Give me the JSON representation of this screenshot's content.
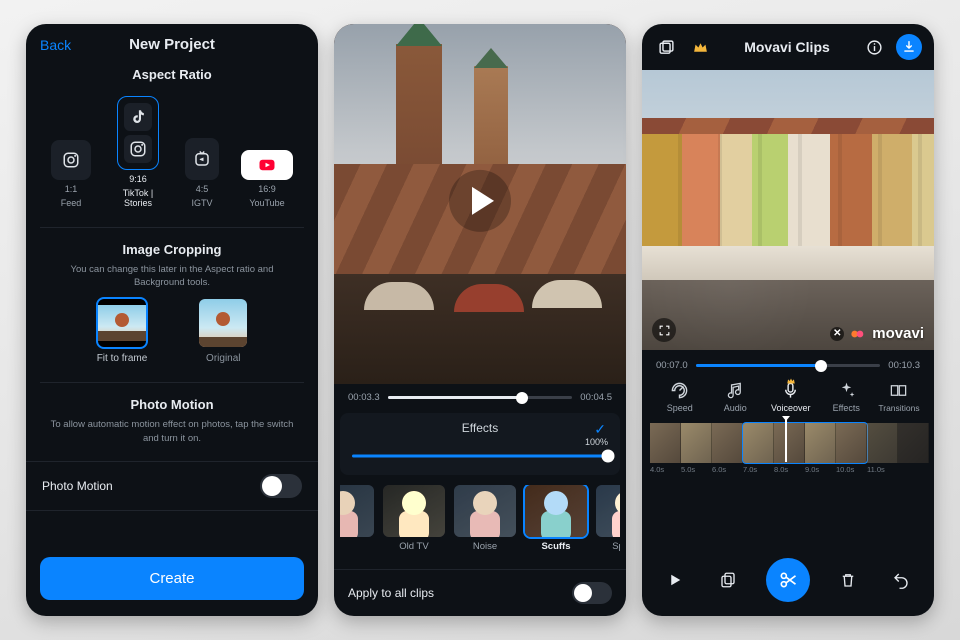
{
  "screen1": {
    "back": "Back",
    "title": "New Project",
    "aspect_ratio": {
      "heading": "Aspect Ratio",
      "options": [
        {
          "ratio": "1:1",
          "name": "Feed"
        },
        {
          "ratio": "9:16",
          "name": "TikTok | Stories"
        },
        {
          "ratio": "4:5",
          "name": "IGTV"
        },
        {
          "ratio": "16:9",
          "name": "YouTube"
        }
      ]
    },
    "image_cropping": {
      "heading": "Image Cropping",
      "help": "You can change this later in the Aspect ratio and Background tools.",
      "options": [
        {
          "label": "Fit to frame"
        },
        {
          "label": "Original"
        }
      ]
    },
    "photo_motion": {
      "heading": "Photo Motion",
      "help": "To allow automatic motion effect on photos, tap the switch and turn it on.",
      "row_label": "Photo Motion",
      "enabled": false
    },
    "create": "Create"
  },
  "screen2": {
    "current_time": "00:03.3",
    "total_time": "00:04.5",
    "progress_pct": 73,
    "effects": {
      "heading": "Effects",
      "intensity_pct": "100%",
      "options": [
        "Old TV",
        "Noise",
        "Scuffs",
        "Sparks"
      ],
      "selected": "Scuffs"
    },
    "apply_all": {
      "label": "Apply to all clips",
      "enabled": false
    }
  },
  "screen3": {
    "title": "Movavi Clips",
    "watermark": "movavi",
    "current_time": "00:07.0",
    "total_time": "00:10.3",
    "progress_pct": 68,
    "tools": [
      "Speed",
      "Audio",
      "Voiceover",
      "Effects",
      "Transitions"
    ],
    "ruler": [
      "4.0s",
      "5.0s",
      "6.0s",
      "7.0s",
      "8.0s",
      "9.0s",
      "10.0s",
      "11.0s"
    ]
  }
}
